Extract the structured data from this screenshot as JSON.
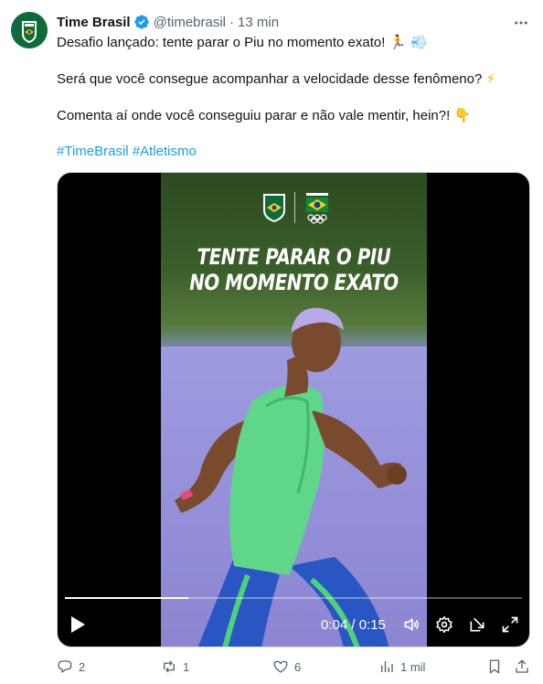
{
  "tweet": {
    "display_name": "Time Brasil",
    "handle": "@timebrasil",
    "separator": "·",
    "time": "13 min",
    "text_line1": "Desafio lançado: tente parar o Piu no momento exato!",
    "text_line1_emoji": "🏃 💨",
    "text_line2": "Será que você consegue acompanhar a velocidade desse fenômeno?",
    "text_line2_emoji": "⚡",
    "text_line3": "Comenta aí onde você conseguiu parar e não vale mentir, hein?!",
    "text_line3_emoji": "👇",
    "hashtags": [
      "#TimeBrasil",
      "#Atletismo"
    ]
  },
  "video": {
    "overlay_title_line1": "TENTE PARAR O PIU",
    "overlay_title_line2": "NO MOMENTO EXATO",
    "time_readout": "0:04 / 0:15",
    "progress": 0.27
  },
  "actions": {
    "replies": "2",
    "reposts": "1",
    "likes": "6",
    "views": "1 mil"
  },
  "colors": {
    "accent": "#1d9bf0",
    "muted": "#536471",
    "brand_green": "#0f6b3c",
    "verified": "#1d9bf0"
  },
  "icons": [
    "verified-badge-icon",
    "more-icon",
    "play-icon",
    "volume-icon",
    "settings-icon",
    "popout-icon",
    "fullscreen-icon",
    "reply-icon",
    "repost-icon",
    "like-icon",
    "views-icon",
    "bookmark-icon",
    "share-icon"
  ]
}
